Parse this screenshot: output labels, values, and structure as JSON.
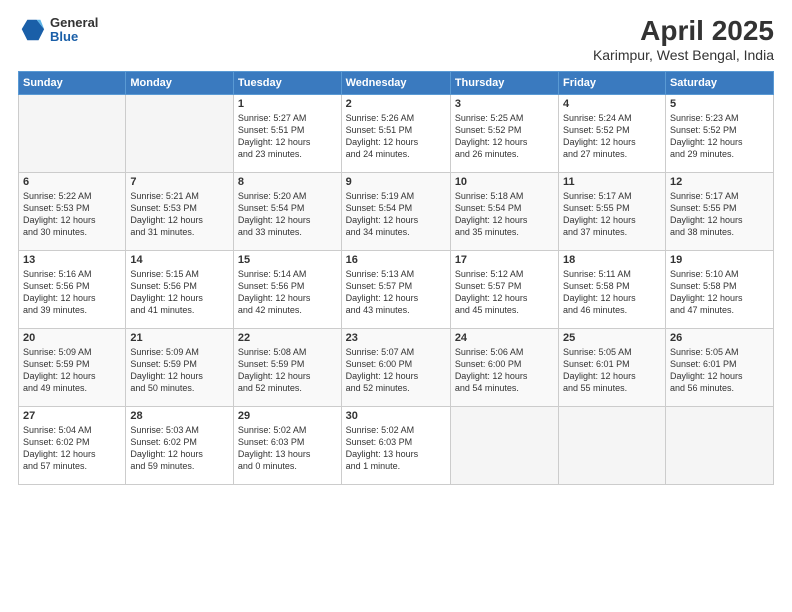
{
  "header": {
    "logo_general": "General",
    "logo_blue": "Blue",
    "title": "April 2025",
    "subtitle": "Karimpur, West Bengal, India"
  },
  "days_of_week": [
    "Sunday",
    "Monday",
    "Tuesday",
    "Wednesday",
    "Thursday",
    "Friday",
    "Saturday"
  ],
  "weeks": [
    [
      {
        "day": "",
        "info": ""
      },
      {
        "day": "",
        "info": ""
      },
      {
        "day": "1",
        "info": "Sunrise: 5:27 AM\nSunset: 5:51 PM\nDaylight: 12 hours\nand 23 minutes."
      },
      {
        "day": "2",
        "info": "Sunrise: 5:26 AM\nSunset: 5:51 PM\nDaylight: 12 hours\nand 24 minutes."
      },
      {
        "day": "3",
        "info": "Sunrise: 5:25 AM\nSunset: 5:52 PM\nDaylight: 12 hours\nand 26 minutes."
      },
      {
        "day": "4",
        "info": "Sunrise: 5:24 AM\nSunset: 5:52 PM\nDaylight: 12 hours\nand 27 minutes."
      },
      {
        "day": "5",
        "info": "Sunrise: 5:23 AM\nSunset: 5:52 PM\nDaylight: 12 hours\nand 29 minutes."
      }
    ],
    [
      {
        "day": "6",
        "info": "Sunrise: 5:22 AM\nSunset: 5:53 PM\nDaylight: 12 hours\nand 30 minutes."
      },
      {
        "day": "7",
        "info": "Sunrise: 5:21 AM\nSunset: 5:53 PM\nDaylight: 12 hours\nand 31 minutes."
      },
      {
        "day": "8",
        "info": "Sunrise: 5:20 AM\nSunset: 5:54 PM\nDaylight: 12 hours\nand 33 minutes."
      },
      {
        "day": "9",
        "info": "Sunrise: 5:19 AM\nSunset: 5:54 PM\nDaylight: 12 hours\nand 34 minutes."
      },
      {
        "day": "10",
        "info": "Sunrise: 5:18 AM\nSunset: 5:54 PM\nDaylight: 12 hours\nand 35 minutes."
      },
      {
        "day": "11",
        "info": "Sunrise: 5:17 AM\nSunset: 5:55 PM\nDaylight: 12 hours\nand 37 minutes."
      },
      {
        "day": "12",
        "info": "Sunrise: 5:17 AM\nSunset: 5:55 PM\nDaylight: 12 hours\nand 38 minutes."
      }
    ],
    [
      {
        "day": "13",
        "info": "Sunrise: 5:16 AM\nSunset: 5:56 PM\nDaylight: 12 hours\nand 39 minutes."
      },
      {
        "day": "14",
        "info": "Sunrise: 5:15 AM\nSunset: 5:56 PM\nDaylight: 12 hours\nand 41 minutes."
      },
      {
        "day": "15",
        "info": "Sunrise: 5:14 AM\nSunset: 5:56 PM\nDaylight: 12 hours\nand 42 minutes."
      },
      {
        "day": "16",
        "info": "Sunrise: 5:13 AM\nSunset: 5:57 PM\nDaylight: 12 hours\nand 43 minutes."
      },
      {
        "day": "17",
        "info": "Sunrise: 5:12 AM\nSunset: 5:57 PM\nDaylight: 12 hours\nand 45 minutes."
      },
      {
        "day": "18",
        "info": "Sunrise: 5:11 AM\nSunset: 5:58 PM\nDaylight: 12 hours\nand 46 minutes."
      },
      {
        "day": "19",
        "info": "Sunrise: 5:10 AM\nSunset: 5:58 PM\nDaylight: 12 hours\nand 47 minutes."
      }
    ],
    [
      {
        "day": "20",
        "info": "Sunrise: 5:09 AM\nSunset: 5:59 PM\nDaylight: 12 hours\nand 49 minutes."
      },
      {
        "day": "21",
        "info": "Sunrise: 5:09 AM\nSunset: 5:59 PM\nDaylight: 12 hours\nand 50 minutes."
      },
      {
        "day": "22",
        "info": "Sunrise: 5:08 AM\nSunset: 5:59 PM\nDaylight: 12 hours\nand 52 minutes."
      },
      {
        "day": "23",
        "info": "Sunrise: 5:07 AM\nSunset: 6:00 PM\nDaylight: 12 hours\nand 52 minutes."
      },
      {
        "day": "24",
        "info": "Sunrise: 5:06 AM\nSunset: 6:00 PM\nDaylight: 12 hours\nand 54 minutes."
      },
      {
        "day": "25",
        "info": "Sunrise: 5:05 AM\nSunset: 6:01 PM\nDaylight: 12 hours\nand 55 minutes."
      },
      {
        "day": "26",
        "info": "Sunrise: 5:05 AM\nSunset: 6:01 PM\nDaylight: 12 hours\nand 56 minutes."
      }
    ],
    [
      {
        "day": "27",
        "info": "Sunrise: 5:04 AM\nSunset: 6:02 PM\nDaylight: 12 hours\nand 57 minutes."
      },
      {
        "day": "28",
        "info": "Sunrise: 5:03 AM\nSunset: 6:02 PM\nDaylight: 12 hours\nand 59 minutes."
      },
      {
        "day": "29",
        "info": "Sunrise: 5:02 AM\nSunset: 6:03 PM\nDaylight: 13 hours\nand 0 minutes."
      },
      {
        "day": "30",
        "info": "Sunrise: 5:02 AM\nSunset: 6:03 PM\nDaylight: 13 hours\nand 1 minute."
      },
      {
        "day": "",
        "info": ""
      },
      {
        "day": "",
        "info": ""
      },
      {
        "day": "",
        "info": ""
      }
    ]
  ]
}
